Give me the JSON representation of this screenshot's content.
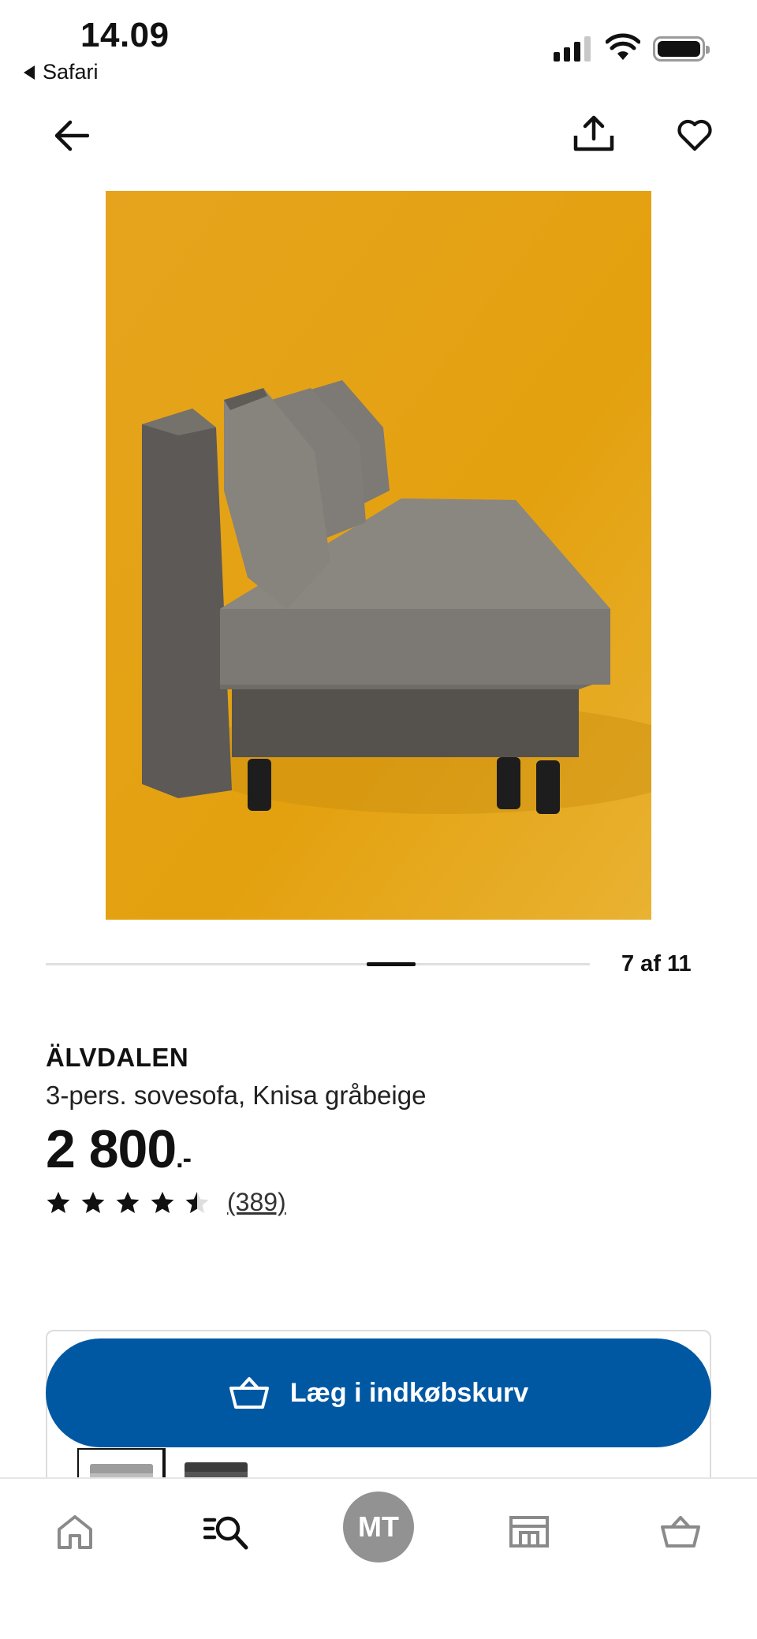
{
  "status_bar": {
    "time": "14.09",
    "back_app_label": "Safari"
  },
  "header": {
    "back_icon": "arrow-left-icon",
    "share_icon": "share-icon",
    "favorite_icon": "heart-icon"
  },
  "gallery": {
    "counter": "7 af 11",
    "current_image": 7,
    "total_images": 11,
    "background_color": "#E8A812"
  },
  "product": {
    "name": "ÄLVDALEN",
    "description": "3-pers. sovesofa, Knisa gråbeige",
    "price": "2 800",
    "price_suffix": ".-",
    "rating": 4.5,
    "rating_max": 5,
    "review_count": "(389)"
  },
  "cart": {
    "button_label": "Læg i indkøbskurv",
    "button_icon": "basket-icon",
    "button_color": "#0058A3",
    "variants": [
      {
        "name": "light-gray-variant",
        "selected": true
      },
      {
        "name": "dark-gray-variant",
        "selected": false
      }
    ]
  },
  "tab_bar": {
    "items": [
      {
        "icon": "home-icon",
        "active": false
      },
      {
        "icon": "search-icon",
        "active": true
      },
      {
        "icon": "avatar",
        "label": "MT",
        "active": false
      },
      {
        "icon": "store-icon",
        "active": false
      },
      {
        "icon": "basket-icon",
        "active": false
      }
    ]
  }
}
